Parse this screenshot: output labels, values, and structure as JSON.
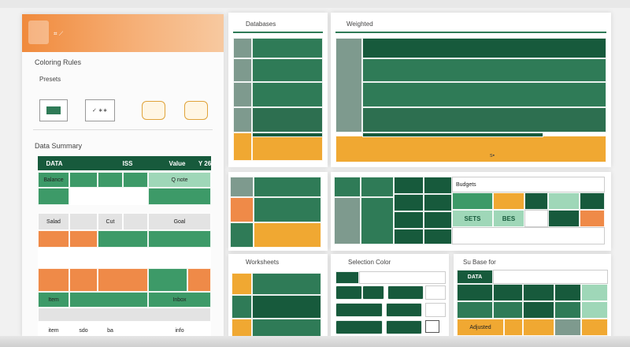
{
  "left_panel": {
    "header_tag": "⌗ ⟋",
    "section_title": "Coloring Rules",
    "subtitle": "Presets",
    "icons": [
      "grid-icon",
      "palette-icon",
      "bag-icon",
      "bag-icon"
    ],
    "icon_caption": "✓ ∗∗",
    "table_title": "Data Summary",
    "table_header": [
      "DATA",
      "ISS",
      "Value",
      "Y 26"
    ],
    "rows": [
      [
        "Balance",
        "",
        "",
        "Q note"
      ],
      [
        "",
        "",
        "",
        ""
      ],
      [
        "Salad",
        "",
        "Cut",
        "Goal"
      ],
      [
        "",
        "",
        "",
        ""
      ],
      [
        "",
        "",
        "",
        ""
      ],
      [
        "",
        "",
        "",
        ""
      ],
      [
        "Item",
        "",
        "",
        "Inbox"
      ],
      [
        "",
        "",
        "",
        ""
      ],
      [
        "item",
        "sdo",
        "ba",
        "info"
      ]
    ]
  },
  "top_panels": {
    "left_title": "Databases",
    "right_title": "Weighted",
    "bottom_label": "s▪"
  },
  "mid_panel": {
    "label_a": "Budgets",
    "label_b": "SETS",
    "label_c": "BES"
  },
  "bottom_panels": {
    "left_title": "Worksheets",
    "middle_title": "Selection Color",
    "right_title": "Su Base for",
    "right_header": "DATA",
    "right_caption": "Adjusted"
  }
}
